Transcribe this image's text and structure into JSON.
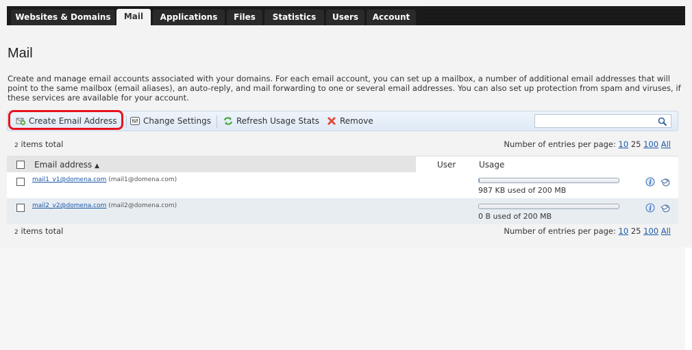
{
  "tabs": [
    {
      "label": "Websites & Domains",
      "active": false
    },
    {
      "label": "Mail",
      "active": true
    },
    {
      "label": "Applications",
      "active": false
    },
    {
      "label": "Files",
      "active": false
    },
    {
      "label": "Statistics",
      "active": false
    },
    {
      "label": "Users",
      "active": false
    },
    {
      "label": "Account",
      "active": false
    }
  ],
  "page": {
    "title": "Mail",
    "description": "Create and manage email accounts associated with your domains. For each email account, you can set up a mailbox, a number of additional email addresses that will point to the same mailbox (email aliases), an auto-reply, and mail forwarding to one or several email addresses. You can also set up protection from spam and viruses, if these services are available for your account."
  },
  "toolbar": {
    "create_label": "Create Email Address",
    "change_label": "Change Settings",
    "refresh_label": "Refresh Usage Stats",
    "remove_label": "Remove",
    "search_placeholder": "",
    "icons": [
      "mail-add-icon",
      "settings-icon",
      "refresh-icon",
      "remove-icon",
      "search-icon"
    ]
  },
  "list": {
    "items_total_num": "2",
    "items_total_label": "items total",
    "per_page_label": "Number of entries per page:",
    "per_page_options": [
      "10",
      "25",
      "100",
      "All"
    ],
    "columns": {
      "email": "Email address",
      "user": "User",
      "usage": "Usage"
    },
    "rows": [
      {
        "email": "mail1_v1@domena.com",
        "alias": "(mail1@domena.com)",
        "usage_text": "987 KB used of 200 MB",
        "usage_fraction": 0.005
      },
      {
        "email": "mail2_v2@domena.com",
        "alias": "(mail2@domena.com)",
        "usage_text": "0 B used of 200 MB",
        "usage_fraction": 0
      }
    ]
  },
  "colors": {
    "accent": "#1a57a8",
    "highlight": "#e8101a",
    "toolbar": "#dfe9f5"
  }
}
